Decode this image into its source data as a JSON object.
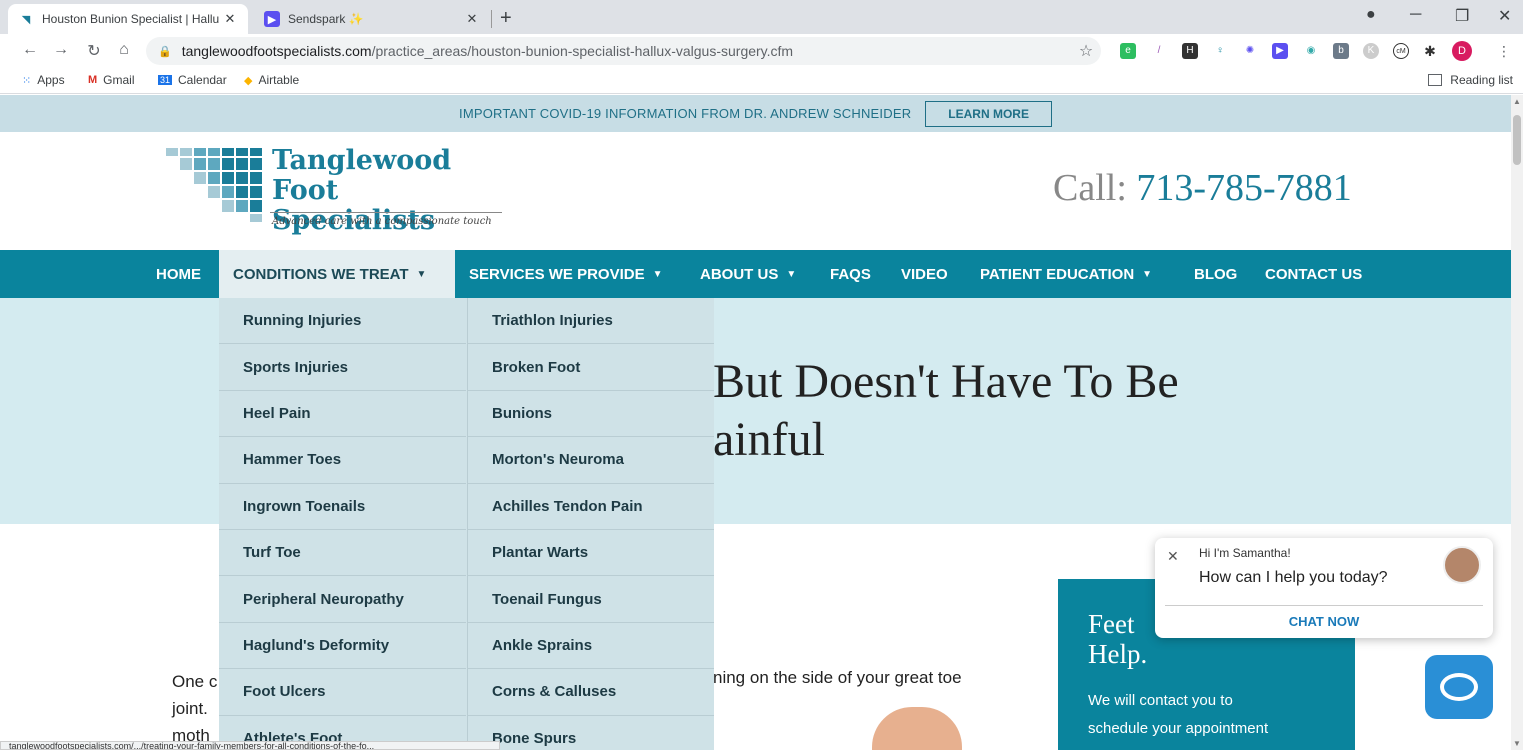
{
  "browser": {
    "tabs": [
      {
        "title": "Houston Bunion Specialist | Hallu",
        "active": true
      },
      {
        "title": "Sendspark",
        "emoji": "✨",
        "active": false
      }
    ],
    "url_host": "tanglewoodfootspecialists.com",
    "url_path": "/practice_areas/houston-bunion-specialist-hallux-valgus-surgery.cfm",
    "profile_initial": "D",
    "bookmarks": [
      "Apps",
      "Gmail",
      "Calendar",
      "Airtable"
    ],
    "reading_list": "Reading list",
    "status_url": "tanglewoodfootspecialists.com/.../treating-your-family-members-for-all-conditions-of-the-fo..."
  },
  "covid": {
    "text": "IMPORTANT COVID-19 INFORMATION FROM DR. ANDREW SCHNEIDER",
    "button": "LEARN MORE"
  },
  "header": {
    "brand_line1": "Tanglewood",
    "brand_line2": "Foot Specialists",
    "tagline": "Advanced care with a compassionate touch",
    "call_label": "Call:",
    "phone": "713-785-7881"
  },
  "nav": [
    {
      "label": "HOME"
    },
    {
      "label": "CONDITIONS WE TREAT",
      "dropdown": true
    },
    {
      "label": "SERVICES WE PROVIDE",
      "dropdown": true
    },
    {
      "label": "ABOUT US",
      "dropdown": true
    },
    {
      "label": "FAQS"
    },
    {
      "label": "VIDEO"
    },
    {
      "label": "PATIENT EDUCATION",
      "dropdown": true
    },
    {
      "label": "BLOG"
    },
    {
      "label": "CONTACT US"
    }
  ],
  "dropdown": {
    "left": [
      "Running Injuries",
      "Sports Injuries",
      "Heel Pain",
      "Hammer Toes",
      "Ingrown Toenails",
      "Turf Toe",
      "Peripheral Neuropathy",
      "Haglund's Deformity",
      "Foot Ulcers",
      "Athlete's Foot"
    ],
    "right": [
      "Triathlon Injuries",
      "Broken Foot",
      "Bunions",
      "Morton's Neuroma",
      "Achilles Tendon Pain",
      "Plantar Warts",
      "Toenail Fungus",
      "Ankle Sprains",
      "Corns & Calluses",
      "Bone Spurs"
    ]
  },
  "hero": {
    "line1": "But Doesn't Have To Be",
    "line2": "ainful"
  },
  "body": {
    "line1": "One c",
    "line2": "joint.",
    "line3": "moth",
    "right_fragment": "ning on the side of your great toe"
  },
  "feet_card": {
    "title1": "Feet",
    "title2": "Help.",
    "text1": "We will contact you to",
    "text2": "schedule your appointment"
  },
  "chat": {
    "greeting": "Hi I'm Samantha!",
    "message": "How can I help you today?",
    "button": "CHAT NOW"
  }
}
